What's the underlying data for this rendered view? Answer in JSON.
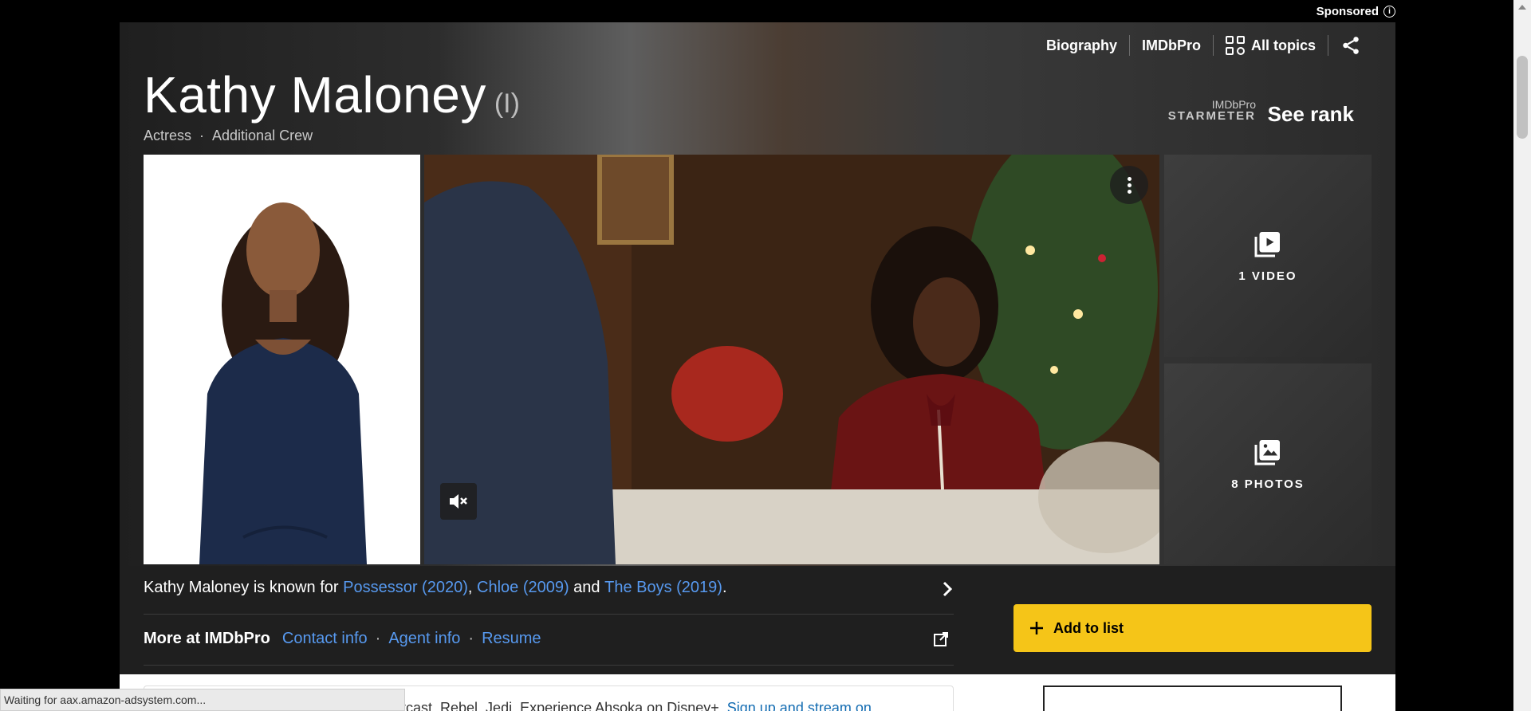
{
  "sponsored": {
    "label": "Sponsored",
    "info": "i"
  },
  "nav": {
    "biography": "Biography",
    "imdbpro": "IMDbPro",
    "all_topics": "All topics"
  },
  "person": {
    "name": "Kathy Maloney",
    "disambiguation": "(I)",
    "roles": [
      "Actress",
      "Additional Crew"
    ],
    "separator": "·"
  },
  "starmeter": {
    "pro_label": "IMDbPro",
    "label": "STARMETER",
    "rank_label": "See rank"
  },
  "media": {
    "videos_label": "1 VIDEO",
    "photos_label": "8 PHOTOS"
  },
  "known_for": {
    "prefix": "Kathy Maloney is known for ",
    "titles": [
      "Possessor (2020)",
      "Chloe (2009)",
      "The Boys (2019)"
    ],
    "comma": ", ",
    "and": " and ",
    "period": "."
  },
  "more_imdbpro": {
    "heading": "More at IMDbPro",
    "links": [
      "Contact info",
      "Agent info",
      "Resume"
    ],
    "separator": "·"
  },
  "add_to_list": {
    "label": "Add to list"
  },
  "promo": {
    "text": "Outcast. Rebel. Jedi. Experience Ahsoka on Disney+. ",
    "link": "Sign up and stream on"
  },
  "status_bar": {
    "text": "Waiting for aax.amazon-adsystem.com..."
  },
  "colors": {
    "accent": "#f5c518",
    "link": "#5799ef",
    "background": "#000000"
  }
}
